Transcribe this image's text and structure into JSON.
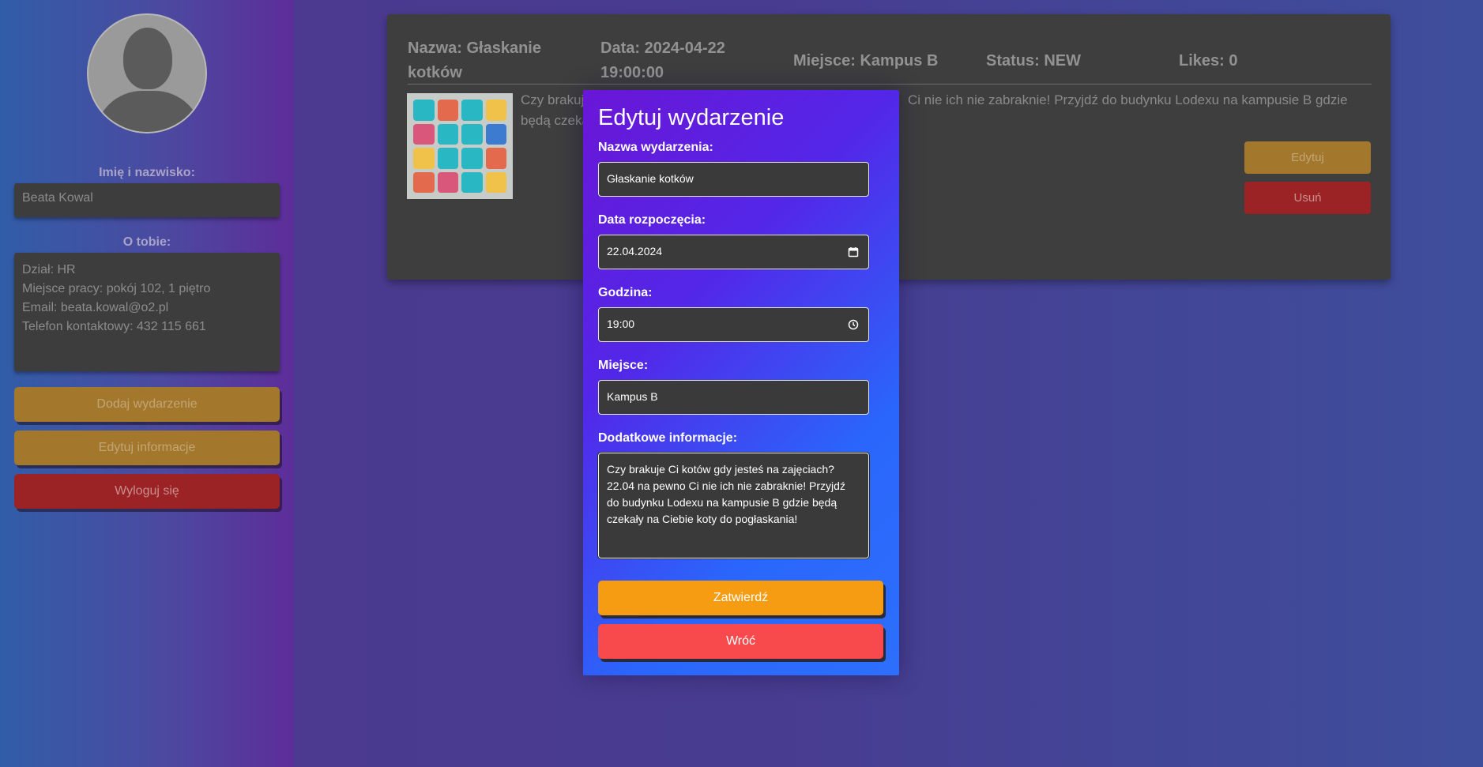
{
  "sidebar": {
    "name_label": "Imię i nazwisko:",
    "name_value": "Beata Kowal",
    "about_label": "O tobie:",
    "about_lines": [
      "Dział: HR",
      "Miejsce pracy: pokój 102, 1 piętro",
      "Email: beata.kowal@o2.pl",
      "Telefon kontaktowy: 432 115 661"
    ],
    "add_event": "Dodaj wydarzenie",
    "edit_info": "Edytuj informacje",
    "logout": "Wyloguj się"
  },
  "event": {
    "name_line1": "Nazwa: Głaskanie",
    "name_line2": "kotków",
    "date_line1": "Data: 2024-04-22",
    "date_line2": "19:00:00",
    "place": "Miejsce: Kampus B",
    "status": "Status: NEW",
    "likes": "Likes: 0",
    "desc_line1_left": "Czy brakuj",
    "desc_line1_right": "Ci nie ich nie zabraknie! Przyjdź do budynku Lodexu na kampusie B gdzie",
    "desc_line2_left": "będą czeka",
    "edit_button": "Edytuj",
    "delete_button": "Usuń"
  },
  "modal": {
    "title": "Edytuj wydarzenie",
    "name_label": "Nazwa wydarzenia:",
    "name_value": "Głaskanie kotków",
    "date_label": "Data rozpoczęcia:",
    "date_value": "22.04.2024",
    "time_label": "Godzina:",
    "time_value": "19:00",
    "place_label": "Miejsce:",
    "place_value": "Kampus B",
    "info_label": "Dodatkowe informacje:",
    "info_lines": [
      "Czy brakuje Ci kotów gdy jesteś na zajęciach?",
      "22.04 na pewno Ci nie ich nie zabraknie! Przyjdź",
      "do budynku Lodexu na kampusie B gdzie będą",
      "czekały na Ciebie koty do pogłaskania!"
    ],
    "submit": "Zatwierdź",
    "back": "Wróć"
  },
  "colors": {
    "modal_gradient_start": "#6a16d6",
    "modal_gradient_end": "#2d6ffc",
    "submit_button": "#f59c12",
    "back_button": "#f84a4c"
  }
}
